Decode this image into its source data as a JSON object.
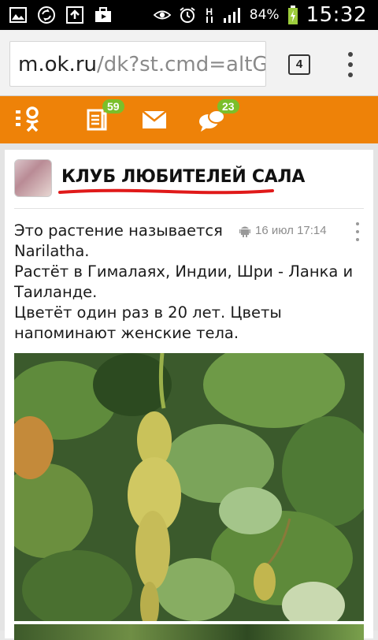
{
  "status_bar": {
    "icons_left": [
      "image-icon",
      "sync-icon",
      "upload-icon",
      "briefcase-play-icon"
    ],
    "icons_right": [
      "eye-icon",
      "alarm-icon",
      "network-h-icon",
      "signal-icon"
    ],
    "network_label": "H",
    "battery_percent": "84%",
    "time": "15:32"
  },
  "browser": {
    "url_host": "m.ok.ru",
    "url_path": "/dk?st.cmd=altGro",
    "tab_count": "4"
  },
  "toolbar": {
    "accent": "#ee8208",
    "items": [
      {
        "name": "ok-logo",
        "badge": ""
      },
      {
        "name": "feed",
        "badge": "59"
      },
      {
        "name": "messages",
        "badge": ""
      },
      {
        "name": "discussions",
        "badge": "23"
      }
    ],
    "badge_color": "#7bbf2a"
  },
  "post": {
    "group_title": "КЛУБ ЛЮБИТЕЛЕЙ САЛА",
    "timestamp": "16 июл 17:14",
    "source_icon": "android-icon",
    "text_line1": "Это растение называется Narilatha.",
    "text_line2": "Растёт в Гималаях, Индии, Шри - Ланка и Таиланде.",
    "text_line3": "Цветёт один раз в 20 лет. Цветы напоминают женские тела."
  }
}
